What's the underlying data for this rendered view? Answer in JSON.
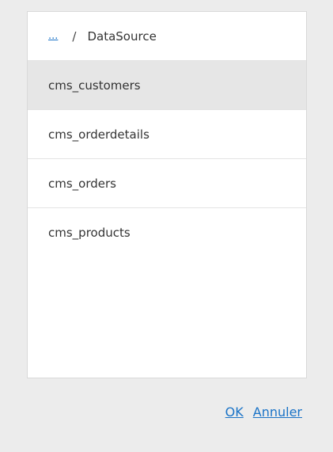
{
  "breadcrumb": {
    "up_link": "...",
    "separator": "/",
    "current": "DataSource"
  },
  "items": [
    {
      "label": "cms_customers",
      "selected": true
    },
    {
      "label": "cms_orderdetails",
      "selected": false
    },
    {
      "label": "cms_orders",
      "selected": false
    },
    {
      "label": "cms_products",
      "selected": false
    }
  ],
  "actions": {
    "ok_label": "OK",
    "cancel_label": "Annuler"
  },
  "colors": {
    "link": "#1a73c7",
    "selected_bg": "#e6e6e6",
    "page_bg": "#ececec"
  }
}
